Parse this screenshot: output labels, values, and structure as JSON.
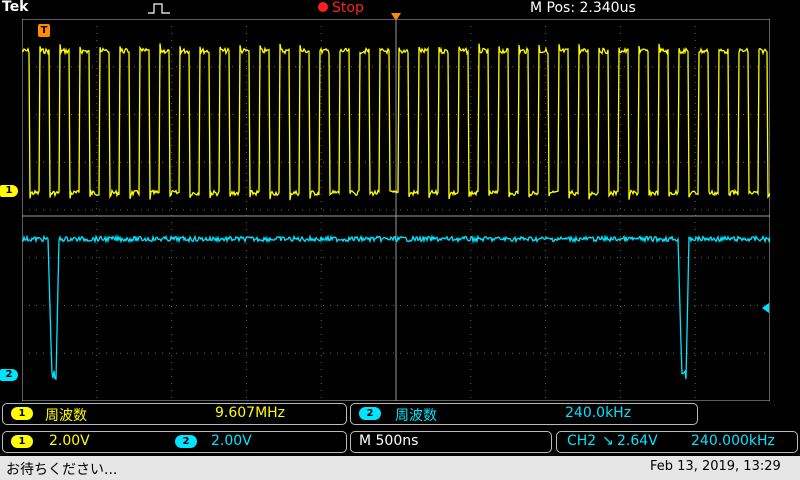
{
  "top": {
    "brand": "Tek",
    "run_state": "Stop",
    "mpos": "M Pos: 2.340us"
  },
  "markers": {
    "trigger_badge": "T",
    "ch1": "1",
    "ch2": "2"
  },
  "measurements": [
    {
      "channel": "1",
      "label": "周波数",
      "value": "9.607MHz",
      "color": "#ffff00"
    },
    {
      "channel": "2",
      "label": "周波数",
      "value": "240.0kHz",
      "color": "#00e5ff"
    }
  ],
  "settings": {
    "ch1": {
      "channel": "1",
      "scale": "2.00V"
    },
    "ch2": {
      "channel": "2",
      "scale": "2.00V"
    },
    "timebase": "M 500ns",
    "trigger": {
      "source": "CH2",
      "slope": "↘",
      "level": "2.64V",
      "frequency": "240.000kHz"
    }
  },
  "status": {
    "message": "お待ちください...",
    "datetime": "Feb 13, 2019, 13:29"
  },
  "colors": {
    "ch1": "#ffff00",
    "ch2": "#00e5ff",
    "trigger": "#ff8c00",
    "stop": "#ff2020"
  }
}
